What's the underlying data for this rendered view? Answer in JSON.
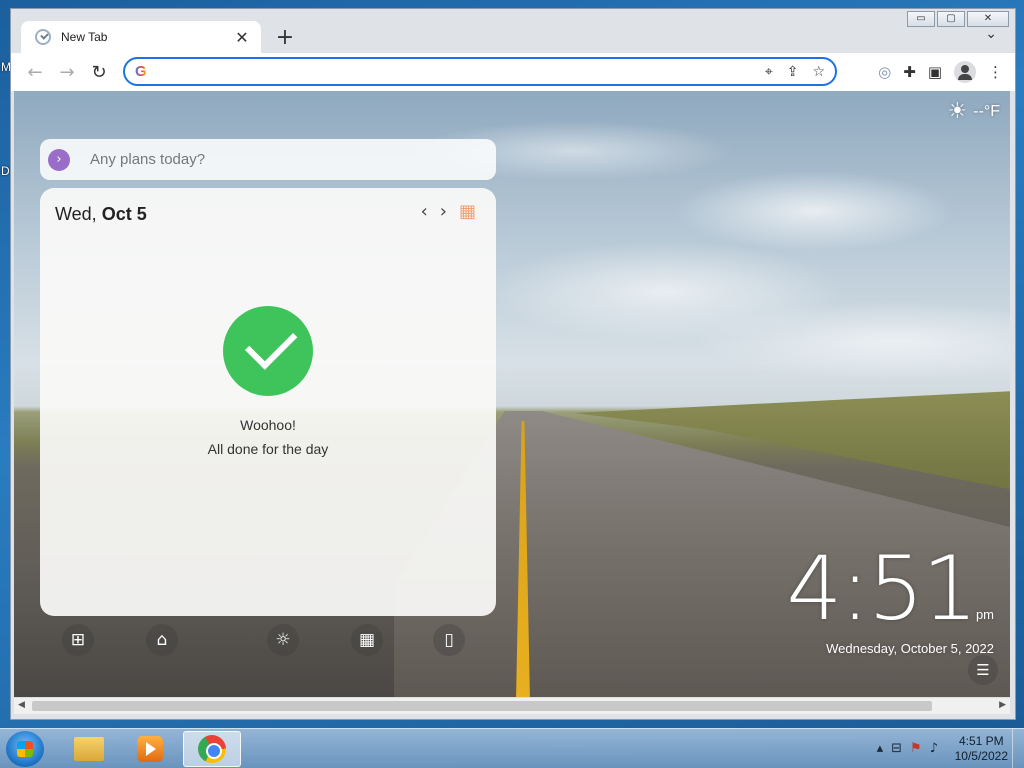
{
  "desktop": {
    "edge_text_1": "M",
    "edge_text_2": "D"
  },
  "window": {
    "minimize": "▭",
    "maximize": "▢",
    "close": "✕"
  },
  "tabstrip": {
    "tab_title": "New Tab",
    "tab_close": "✕",
    "new_tab": "+",
    "tab_list": "⌄"
  },
  "toolbar": {
    "back": "←",
    "forward": "→",
    "reload": "↻",
    "omnibox": {
      "placeholder": "",
      "value": "",
      "g_icon": "G"
    },
    "omni_icons": [
      "location-icon",
      "share-icon",
      "bookmark-star-icon"
    ],
    "right_icons": [
      "extension-icon",
      "puzzle-icon",
      "side-panel-icon",
      "profile-avatar-icon",
      "kebab-menu-icon"
    ]
  },
  "weather": {
    "temp": "--°F",
    "icon": "sun-icon"
  },
  "plans": {
    "placeholder": "Any plans today?",
    "chevron": "›"
  },
  "todo_card": {
    "day": "Wed,",
    "date": "Oct 5",
    "prev": "‹",
    "next": "›",
    "status_title": "Woohoo!",
    "status_sub": "All done for the day",
    "check_color": "#3fc45c"
  },
  "dock": {
    "icons": [
      "grid-icon",
      "home-icon",
      "sun-icon",
      "calendar-icon",
      "document-icon"
    ]
  },
  "clock": {
    "time": "4:51",
    "ampm": "pm",
    "date": "Wednesday, October 5, 2022"
  },
  "taskbar": {
    "apps": [
      "explorer",
      "media-player",
      "chrome"
    ],
    "tray_time": "4:51 PM",
    "tray_date": "10/5/2022"
  },
  "colors": {
    "accent": "#1a73e8",
    "plans_chevron": "#9a6dc8",
    "calendar_icon": "#f0a070"
  }
}
